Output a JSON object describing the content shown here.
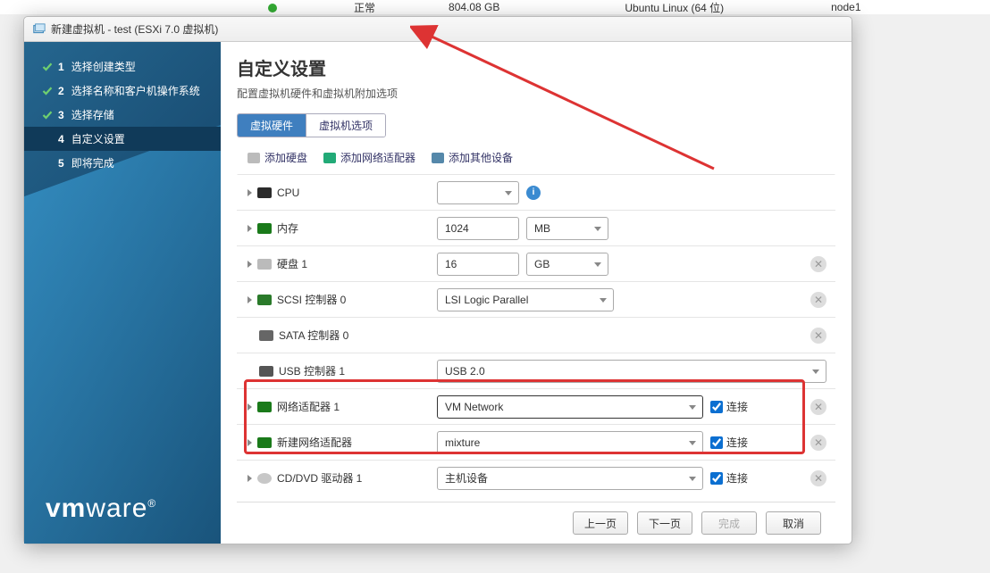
{
  "backdrop": {
    "status": "正常",
    "storage": "804.08 GB",
    "os": "Ubuntu Linux (64 位)",
    "node": "node1"
  },
  "window_title": "新建虚拟机 - test (ESXi 7.0 虚拟机)",
  "steps": {
    "s1": "选择创建类型",
    "s2": "选择名称和客户机操作系统",
    "s3": "选择存储",
    "s4": "自定义设置",
    "s5": "即将完成"
  },
  "page": {
    "heading": "自定义设置",
    "subtitle": "配置虚拟机硬件和虚拟机附加选项"
  },
  "tabs": {
    "hw": "虚拟硬件",
    "opt": "虚拟机选项"
  },
  "toolbar": {
    "add_disk": "添加硬盘",
    "add_nic": "添加网络适配器",
    "add_other": "添加其他设备"
  },
  "rows": {
    "cpu": {
      "label": "CPU",
      "value": ""
    },
    "mem": {
      "label": "内存",
      "value": "1024",
      "unit": "MB"
    },
    "disk": {
      "label": "硬盘 1",
      "value": "16",
      "unit": "GB"
    },
    "scsi": {
      "label": "SCSI 控制器 0",
      "value": "LSI Logic Parallel"
    },
    "sata": {
      "label": "SATA 控制器 0"
    },
    "usb": {
      "label": "USB 控制器 1",
      "value": "USB 2.0"
    },
    "nic1": {
      "label": "网络适配器 1",
      "value": "VM Network",
      "connect": "连接"
    },
    "nic2": {
      "label": "新建网络适配器",
      "value": "mixture",
      "connect": "连接"
    },
    "cd": {
      "label": "CD/DVD 驱动器 1",
      "value": "主机设备",
      "connect": "连接"
    }
  },
  "footer": {
    "back": "上一页",
    "next": "下一页",
    "finish": "完成",
    "cancel": "取消"
  },
  "logo": {
    "a": "vm",
    "b": "ware"
  }
}
